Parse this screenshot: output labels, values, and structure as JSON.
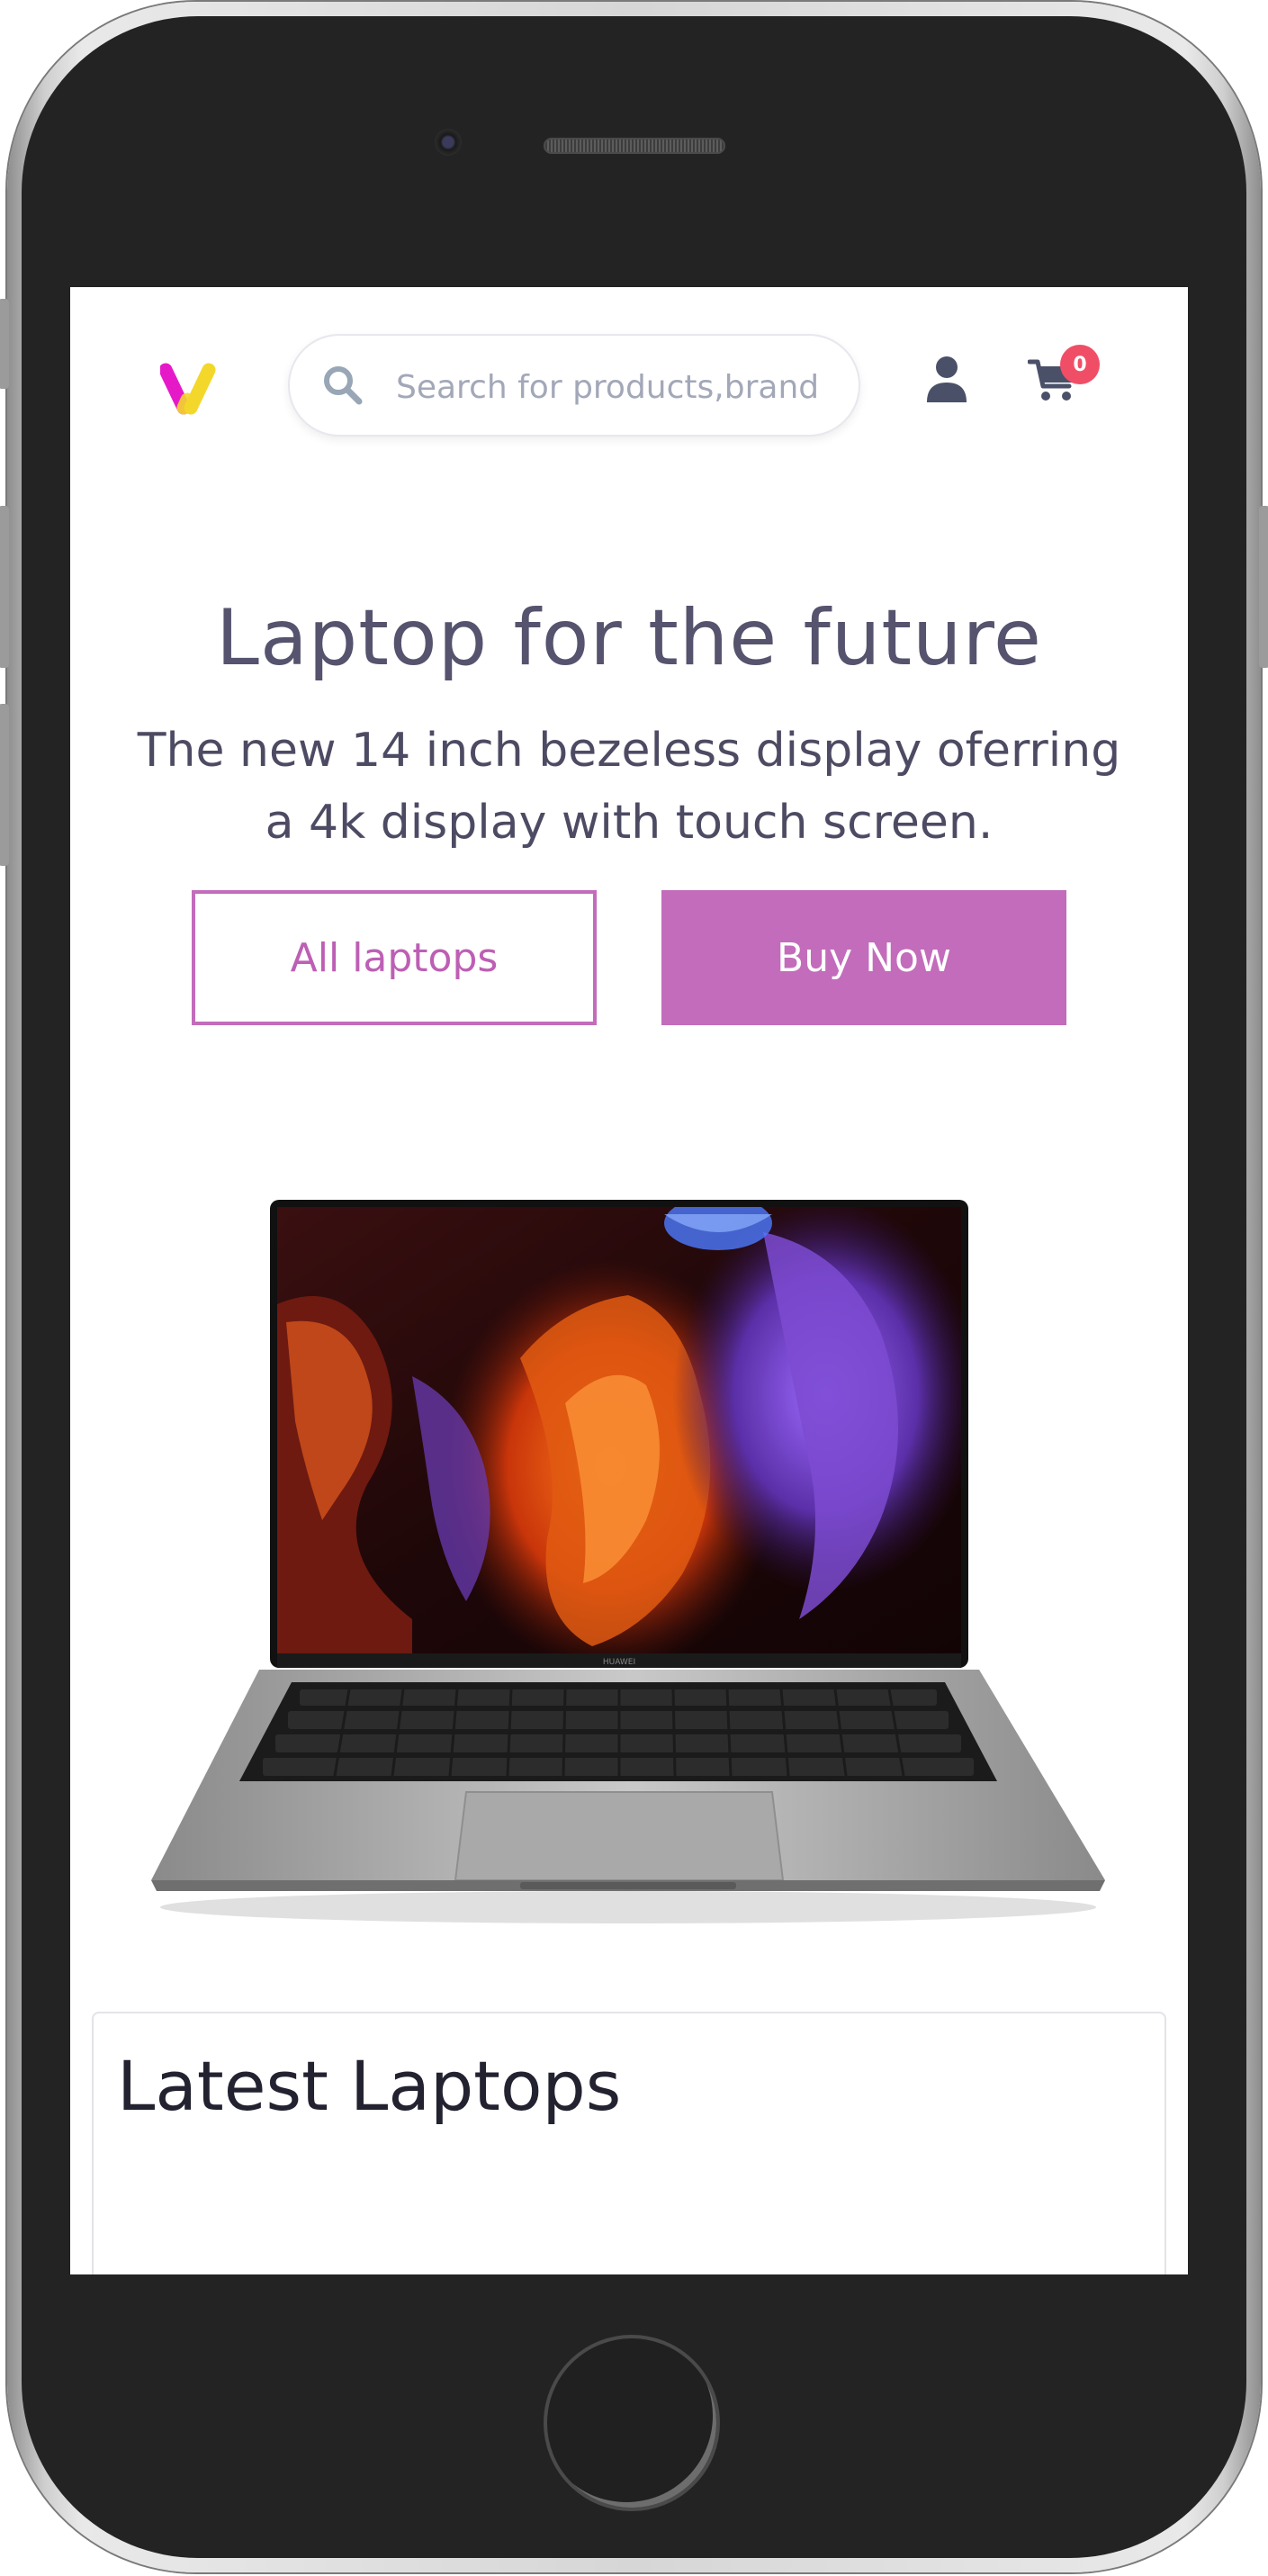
{
  "header": {
    "logo": "v-logo",
    "search": {
      "placeholder": "Search for products,brand",
      "value": ""
    },
    "icons": {
      "search": "search-icon",
      "user": "user-icon",
      "cart": "cart-icon"
    },
    "cart_count": "0"
  },
  "hero": {
    "title": "Laptop for the future",
    "subtitle": "The new 14 inch bezeless display oferring a 4k display with touch screen.",
    "secondary_button": "All laptops",
    "primary_button": "Buy Now",
    "image": "laptop-image",
    "laptop_brand": "HUAWEI"
  },
  "section": {
    "title": "Latest Laptops"
  },
  "colors": {
    "accent": "#c36cbb",
    "heading": "#55536d",
    "text": "#4d4b63",
    "icon": "#4a5068",
    "badge": "#f04e67",
    "logo_magenta": "#e619c9",
    "logo_yellow": "#f3d72b"
  }
}
